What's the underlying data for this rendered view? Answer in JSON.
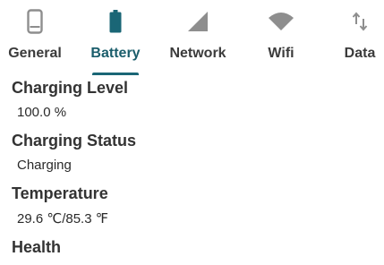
{
  "tabs": [
    {
      "label": "General",
      "icon": "phone-icon"
    },
    {
      "label": "Battery",
      "icon": "battery-icon",
      "active": true
    },
    {
      "label": "Network",
      "icon": "signal-icon"
    },
    {
      "label": "Wifi",
      "icon": "wifi-icon"
    },
    {
      "label": "Data",
      "icon": "data-transfer-icon"
    }
  ],
  "colors": {
    "active": "#1a6676",
    "inactive_icon": "#8e8e8e",
    "text": "#333333"
  },
  "items": [
    {
      "title": "Charging Level",
      "value": "100.0 %"
    },
    {
      "title": "Charging Status",
      "value": "Charging"
    },
    {
      "title": "Temperature",
      "value": "29.6 ℃/85.3 ℉"
    },
    {
      "title": "Health",
      "value": ""
    }
  ]
}
